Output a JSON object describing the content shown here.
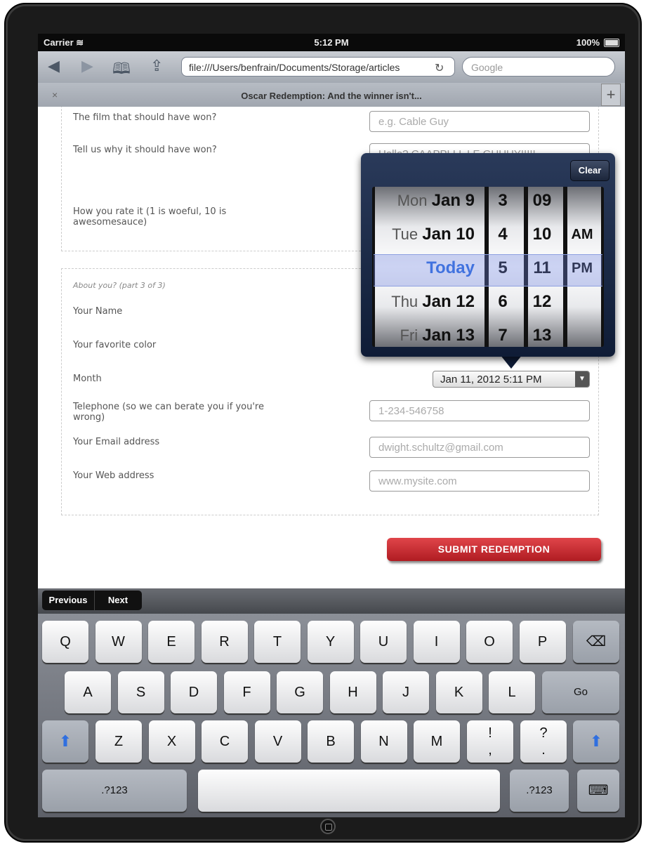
{
  "status_bar": {
    "carrier": "Carrier",
    "time": "5:12 PM",
    "battery": "100%"
  },
  "browser": {
    "url": "file:///Users/benfrain/Documents/Storage/articles",
    "search_placeholder": "Google",
    "tab_title": "Oscar Redemption: And the winner isn't...",
    "tab_close": "×",
    "tab_add": "+"
  },
  "form": {
    "film_label": "The film that should have won?",
    "film_placeholder": "e.g. Cable Guy",
    "why_label": "Tell us why it should have won?",
    "why_value": "Hello? CAAPPLLL LE GUUUY!!!!!",
    "rate_label": "How you rate it (1 is woeful, 10 is awesomesauce)",
    "section_note": "About you? (part 3 of 3)",
    "name_label": "Your Name",
    "color_label": "Your favorite color",
    "month_label": "Month",
    "month_value": "Jan 11, 2012 5:11 PM",
    "phone_label": "Telephone (so we can berate you if you're wrong)",
    "phone_placeholder": "1-234-546758",
    "email_label": "Your Email address",
    "email_placeholder": "dwight.schultz@gmail.com",
    "web_label": "Your Web address",
    "web_placeholder": "www.mysite.com",
    "submit": "SUBMIT REDEMPTION"
  },
  "picker": {
    "clear": "Clear",
    "dates": [
      {
        "dow": "Mon",
        "date": "Jan 9"
      },
      {
        "dow": "Tue",
        "date": "Jan 10"
      },
      {
        "dow": "",
        "date": "Today"
      },
      {
        "dow": "Thu",
        "date": "Jan 12"
      },
      {
        "dow": "Fri",
        "date": "Jan 13"
      }
    ],
    "hours": [
      "3",
      "4",
      "5",
      "6",
      "7"
    ],
    "minutes": [
      "09",
      "10",
      "11",
      "12",
      "13"
    ],
    "ampm": [
      "",
      "AM",
      "PM",
      "",
      ""
    ],
    "selected_index": 2
  },
  "keyboard": {
    "prev": "Previous",
    "next": "Next",
    "row1": [
      "Q",
      "W",
      "E",
      "R",
      "T",
      "Y",
      "U",
      "I",
      "O",
      "P"
    ],
    "row2": [
      "A",
      "S",
      "D",
      "F",
      "G",
      "H",
      "J",
      "K",
      "L"
    ],
    "row3": [
      "Z",
      "X",
      "C",
      "V",
      "B",
      "N",
      "M"
    ],
    "go": "Go",
    "exclaim": "!\n,",
    "question": "?\n.",
    "numbers": ".?123"
  }
}
